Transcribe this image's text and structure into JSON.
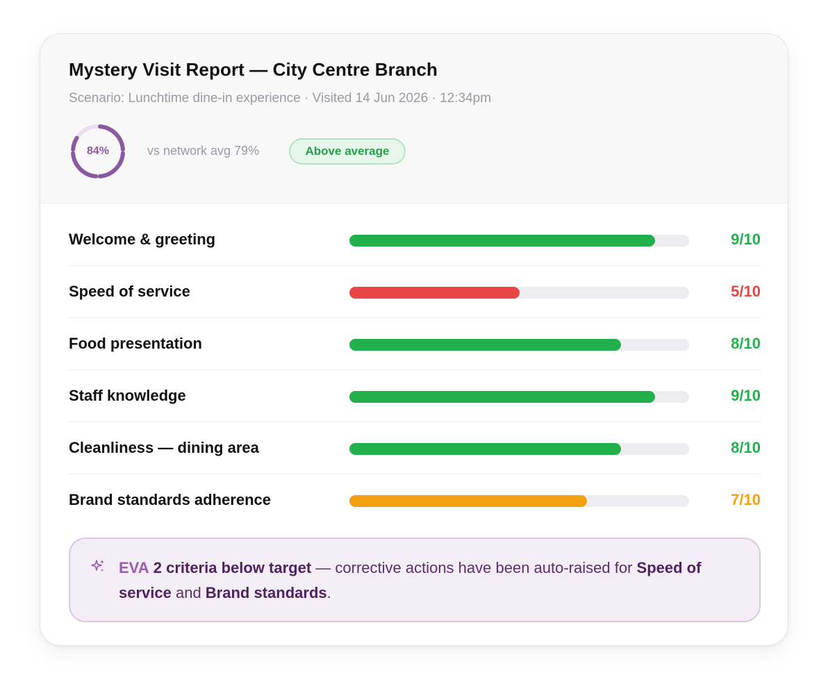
{
  "report": {
    "title": "Mystery Visit Report — City Centre Branch",
    "subtitle": "Scenario: Lunchtime dine-in experience · Visited 14 Jun 2026 · 12:34pm",
    "overall_score": "84%",
    "overall_fraction": 0.84,
    "comparison": "vs network avg 79%",
    "badge": "Above average"
  },
  "criteria": [
    {
      "label": "Welcome & greeting",
      "score_text": "9/10",
      "value": 9,
      "max": 10,
      "color": "#22b04c"
    },
    {
      "label": "Speed of service",
      "score_text": "5/10",
      "value": 5,
      "max": 10,
      "color": "#e84545"
    },
    {
      "label": "Food presentation",
      "score_text": "8/10",
      "value": 8,
      "max": 10,
      "color": "#22b04c"
    },
    {
      "label": "Staff knowledge",
      "score_text": "9/10",
      "value": 9,
      "max": 10,
      "color": "#22b04c"
    },
    {
      "label": "Cleanliness — dining area",
      "score_text": "8/10",
      "value": 8,
      "max": 10,
      "color": "#22b04c"
    },
    {
      "label": "Brand standards adherence",
      "score_text": "7/10",
      "value": 7,
      "max": 10,
      "color": "#f5a00f"
    }
  ],
  "callout": {
    "icon": "sparkle-icon",
    "eva": "EVA",
    "headline": "2 criteria below target",
    "text1": " — corrective actions have been auto-raised for ",
    "item1": "Speed of service",
    "text2": " and ",
    "item2": "Brand standards",
    "text3": "."
  },
  "colors": {
    "accent": "#8b5a9e",
    "good": "#22b04c",
    "bad": "#e84545",
    "warn": "#f5a00f"
  }
}
